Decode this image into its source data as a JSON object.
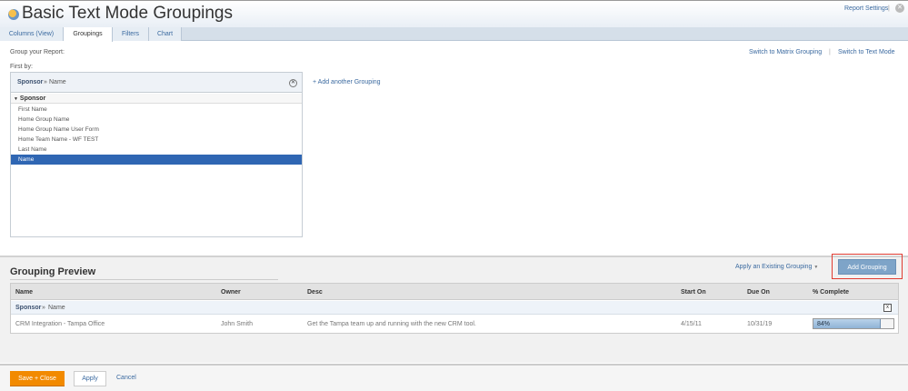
{
  "header": {
    "title": "Basic Text Mode Groupings",
    "report_settings": "Report Settings",
    "separator": "|"
  },
  "tabs": [
    {
      "label": "Columns (View)"
    },
    {
      "label": "Groupings"
    },
    {
      "label": "Filters"
    },
    {
      "label": "Chart"
    }
  ],
  "groupings": {
    "intro": "Group your Report:",
    "first_by": "First by:",
    "selected_category": "Sponsor",
    "selected_sep": "»",
    "selected_field": "Name",
    "add_another": "+ Add another Grouping",
    "switch_matrix": "Switch to Matrix Grouping",
    "switch_sep": "|",
    "switch_text": "Switch to Text Mode",
    "category": "Sponsor",
    "fields": [
      "First Name",
      "Home Group Name",
      "Home Group Name User Form",
      "Home Team Name - WF TEST",
      "Last Name",
      "Name"
    ],
    "selected_index": 5
  },
  "preview": {
    "title": "Grouping Preview",
    "apply_existing": "Apply an Existing Grouping",
    "add_grouping": "Add Grouping",
    "columns": [
      "Name",
      "Owner",
      "Desc",
      "Start On",
      "Due On",
      "% Complete"
    ],
    "group_row": {
      "category": "Sponsor",
      "sep": "»",
      "field": "Name",
      "remove": "x"
    },
    "rows": [
      {
        "name": "CRM Integration - Tampa Office",
        "owner": "John Smith",
        "desc": "Get the Tampa team up and running with the new CRM tool.",
        "start": "4/15/11",
        "due": "10/31/19",
        "complete_label": "84%",
        "complete": 84
      }
    ]
  },
  "footer": {
    "save_close": "Save + Close",
    "apply": "Apply",
    "cancel": "Cancel"
  },
  "colors": {
    "accent": "#f28a00",
    "link": "#3b6aa0",
    "selected": "#2f66b3",
    "highlight": "#e03c31"
  }
}
